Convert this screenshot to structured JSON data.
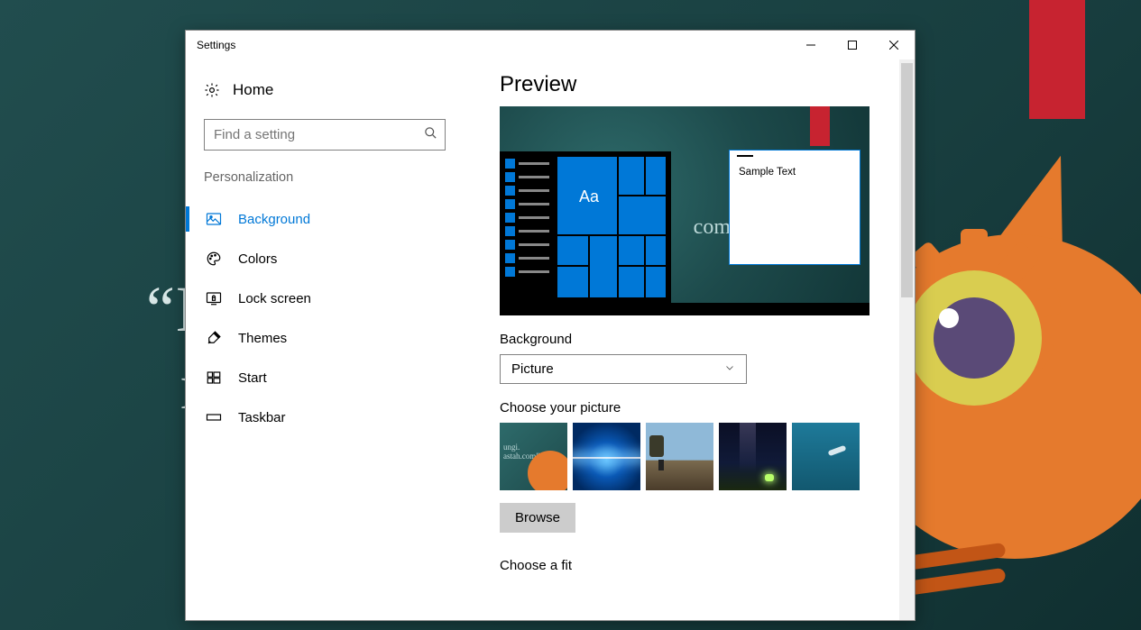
{
  "desktop": {
    "quote": "“K\n  r"
  },
  "window": {
    "title": "Settings"
  },
  "left": {
    "home": "Home",
    "searchPlaceholder": "Find a setting",
    "section": "Personalization",
    "nav": {
      "background": "Background",
      "colors": "Colors",
      "lockscreen": "Lock screen",
      "themes": "Themes",
      "start": "Start",
      "taskbar": "Taskbar"
    }
  },
  "right": {
    "previewHeading": "Preview",
    "sampleText": "Sample Text",
    "previewTile": "Aa",
    "previewQuote": "“Ku\n  m         com”",
    "bgLabel": "Background",
    "bgValue": "Picture",
    "chooseLabel": "Choose your picture",
    "thumb1Text": "ungi.\nastah.com”",
    "browse": "Browse",
    "fitLabel": "Choose a fit"
  }
}
